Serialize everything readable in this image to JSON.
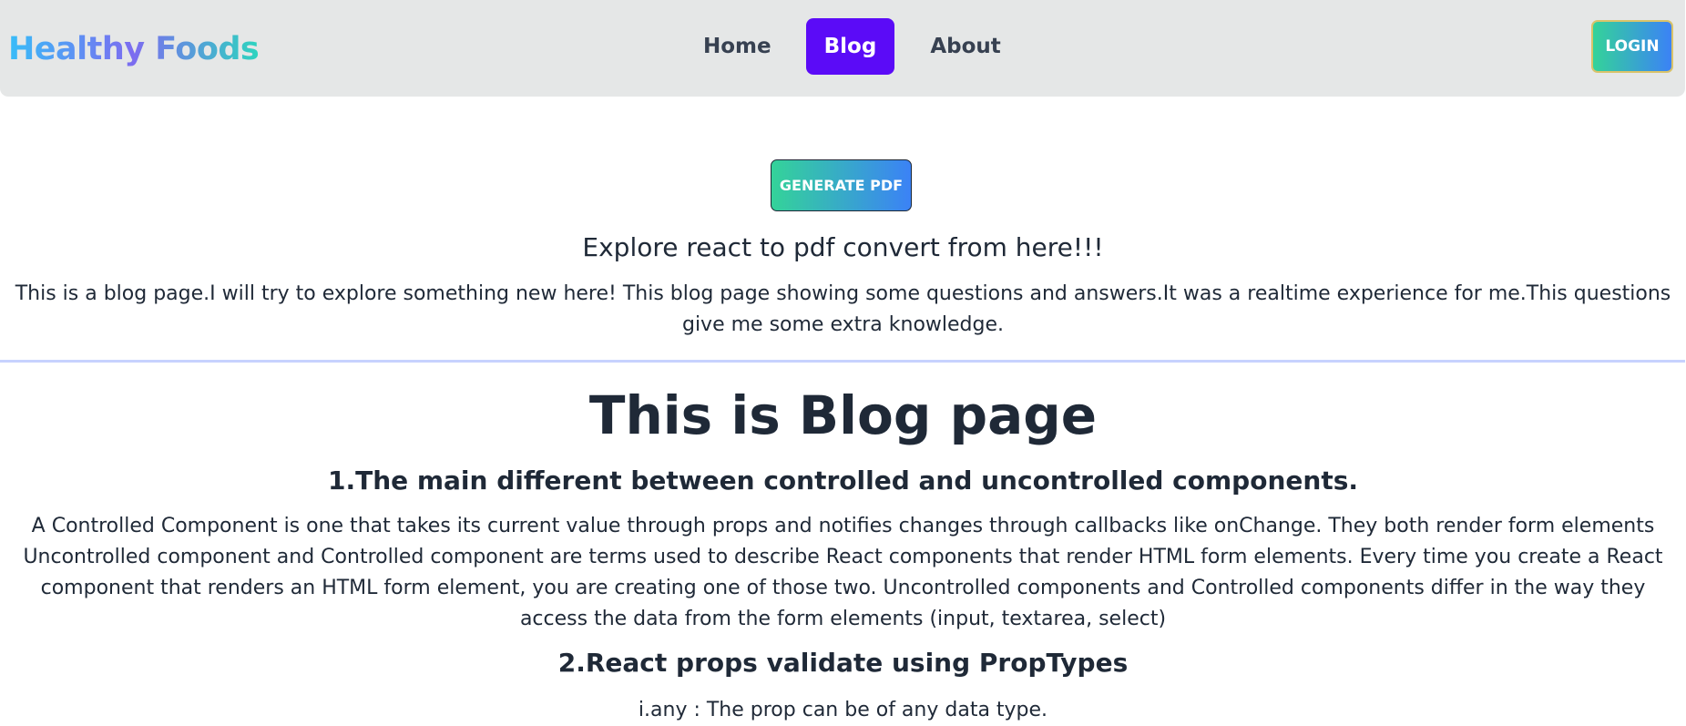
{
  "navbar": {
    "brand": "Healthy Foods",
    "links": [
      {
        "label": "Home",
        "active": false
      },
      {
        "label": "Blog",
        "active": true
      },
      {
        "label": "About",
        "active": false
      }
    ],
    "login_label": "LOGIN"
  },
  "main": {
    "generate_pdf_label": "GENERATE PDF",
    "subtitle": "Explore react to pdf convert from here!!!",
    "intro": "This is a blog page.I will try to explore something new here! This blog page showing some questions and answers.It was a realtime experience for me.This questions give me some extra knowledge.",
    "blog_title": "This is Blog page",
    "questions": [
      {
        "heading": "1.The main different between controlled and uncontrolled components.",
        "answer": "A Controlled Component is one that takes its current value through props and notifies changes through callbacks like onChange. They both render form elements Uncontrolled component and Controlled component are terms used to describe React components that render HTML form elements. Every time you create a React component that renders an HTML form element, you are creating one of those two. Uncontrolled components and Controlled components differ in the way they access the data from the form elements (input, textarea, select)"
      },
      {
        "heading": "2.React props validate using PropTypes",
        "answer": "i.any : The prop can be of any data type."
      }
    ]
  },
  "colors": {
    "navbar_bg": "#e5e7e7",
    "active_tab": "#5b0bf7",
    "gradient_start": "#34d399",
    "gradient_end": "#3b82f6",
    "divider": "#c7d2fe",
    "text": "#1f2937"
  }
}
